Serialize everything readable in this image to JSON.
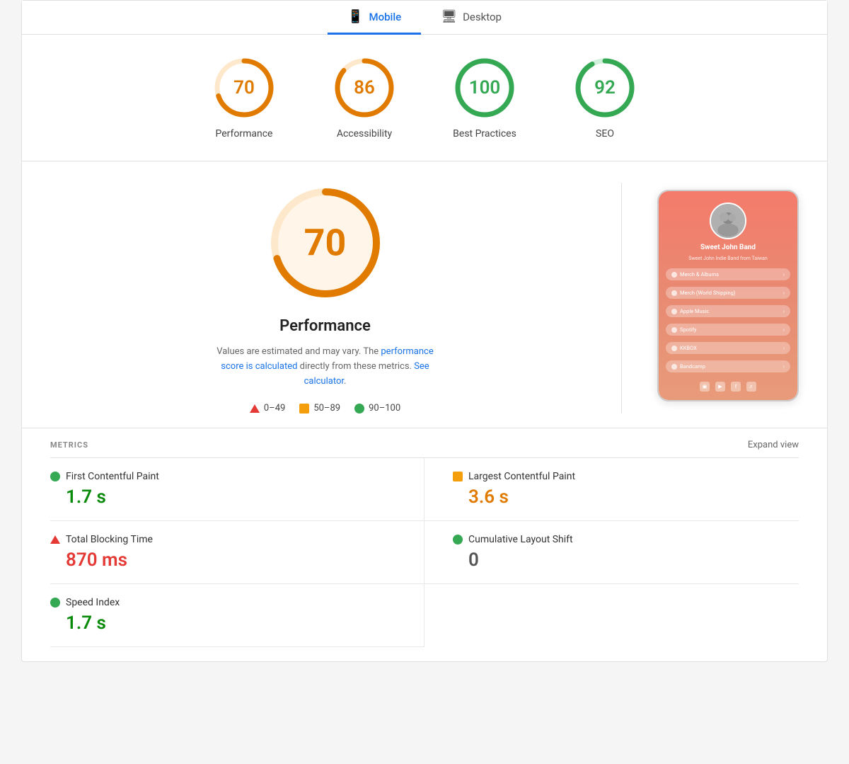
{
  "tabs": [
    {
      "id": "mobile",
      "label": "Mobile",
      "icon": "📱",
      "active": true
    },
    {
      "id": "desktop",
      "label": "Desktop",
      "icon": "🖥",
      "active": false
    }
  ],
  "scores": [
    {
      "id": "performance",
      "value": 70,
      "label": "Performance",
      "color": "#e07b00",
      "track": "#fde8cc",
      "pct": 70
    },
    {
      "id": "accessibility",
      "value": 86,
      "label": "Accessibility",
      "color": "#e07b00",
      "track": "#fde8cc",
      "pct": 86
    },
    {
      "id": "best-practices",
      "value": 100,
      "label": "Best Practices",
      "color": "#34a853",
      "track": "#d0f0dc",
      "pct": 100
    },
    {
      "id": "seo",
      "value": 92,
      "label": "SEO",
      "color": "#34a853",
      "track": "#d0f0dc",
      "pct": 92
    }
  ],
  "big_score": {
    "value": 70,
    "label": "Performance",
    "color": "#e07b00",
    "track": "#fde8cc",
    "pct": 70
  },
  "description": {
    "text_before": "Values are estimated and may vary. The ",
    "link1_text": "performance score is calculated",
    "text_middle": " directly from these metrics. ",
    "link2_text": "See calculator",
    "text_after": "."
  },
  "legend": {
    "items": [
      {
        "id": "fail",
        "range": "0–49",
        "type": "triangle-red"
      },
      {
        "id": "average",
        "range": "50–89",
        "type": "square-orange"
      },
      {
        "id": "pass",
        "range": "90–100",
        "type": "circle-green"
      }
    ]
  },
  "phone": {
    "name": "Sweet John Band",
    "sub": "Sweet John Indie Band from Taiwan",
    "buttons": [
      {
        "label": "Merch & Albums"
      },
      {
        "label": "Merch (World Shipping)"
      },
      {
        "label": "Apple Music"
      },
      {
        "label": "Spotify"
      },
      {
        "label": "KKBOX"
      },
      {
        "label": "Bandcamp"
      }
    ]
  },
  "metrics": {
    "title": "METRICS",
    "expand_label": "Expand view",
    "items": [
      {
        "id": "fcp",
        "label": "First Contentful Paint",
        "value": "1.7 s",
        "status": "green",
        "dot": "green"
      },
      {
        "id": "lcp",
        "label": "Largest Contentful Paint",
        "value": "3.6 s",
        "status": "orange",
        "dot": "orange"
      },
      {
        "id": "tbt",
        "label": "Total Blocking Time",
        "value": "870 ms",
        "status": "red",
        "dot": "red"
      },
      {
        "id": "cls",
        "label": "Cumulative Layout Shift",
        "value": "0",
        "status": "neutral",
        "dot": "green"
      },
      {
        "id": "si",
        "label": "Speed Index",
        "value": "1.7 s",
        "status": "green",
        "dot": "green"
      }
    ]
  }
}
